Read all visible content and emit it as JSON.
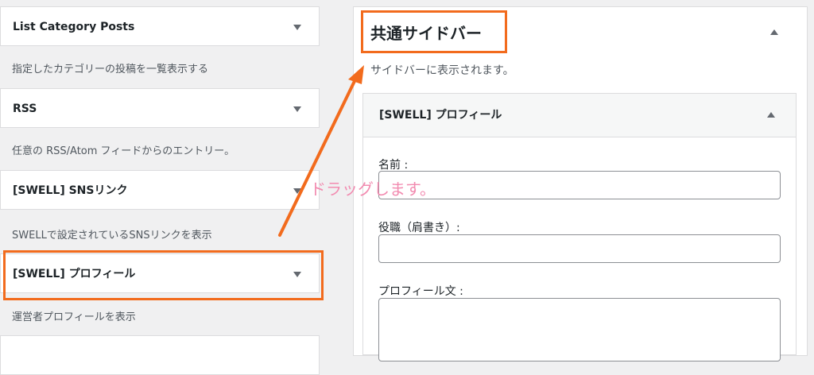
{
  "widget_list": [
    {
      "title": "List Category Posts",
      "description": "指定したカテゴリーの投稿を一覧表示する"
    },
    {
      "title": "RSS",
      "description": "任意の RSS/Atom フィードからのエントリー。"
    },
    {
      "title": "[SWELL] SNSリンク",
      "description": "SWELLで設定されているSNSリンクを表示"
    },
    {
      "title": "[SWELL] プロフィール",
      "description": "運営者プロフィールを表示"
    }
  ],
  "sidebar": {
    "title": "共通サイドバー",
    "description": "サイドバーに表示されます。",
    "widget": {
      "title": "[SWELL] プロフィール",
      "fields": [
        {
          "label": "名前 :"
        },
        {
          "label": "役職（肩書き）:"
        },
        {
          "label": "プロフィール文 :"
        }
      ]
    }
  },
  "annotation": {
    "drag_text": "ドラッグします。",
    "highlight_color": "#f26b1d",
    "drag_text_color": "#f28bb0"
  }
}
